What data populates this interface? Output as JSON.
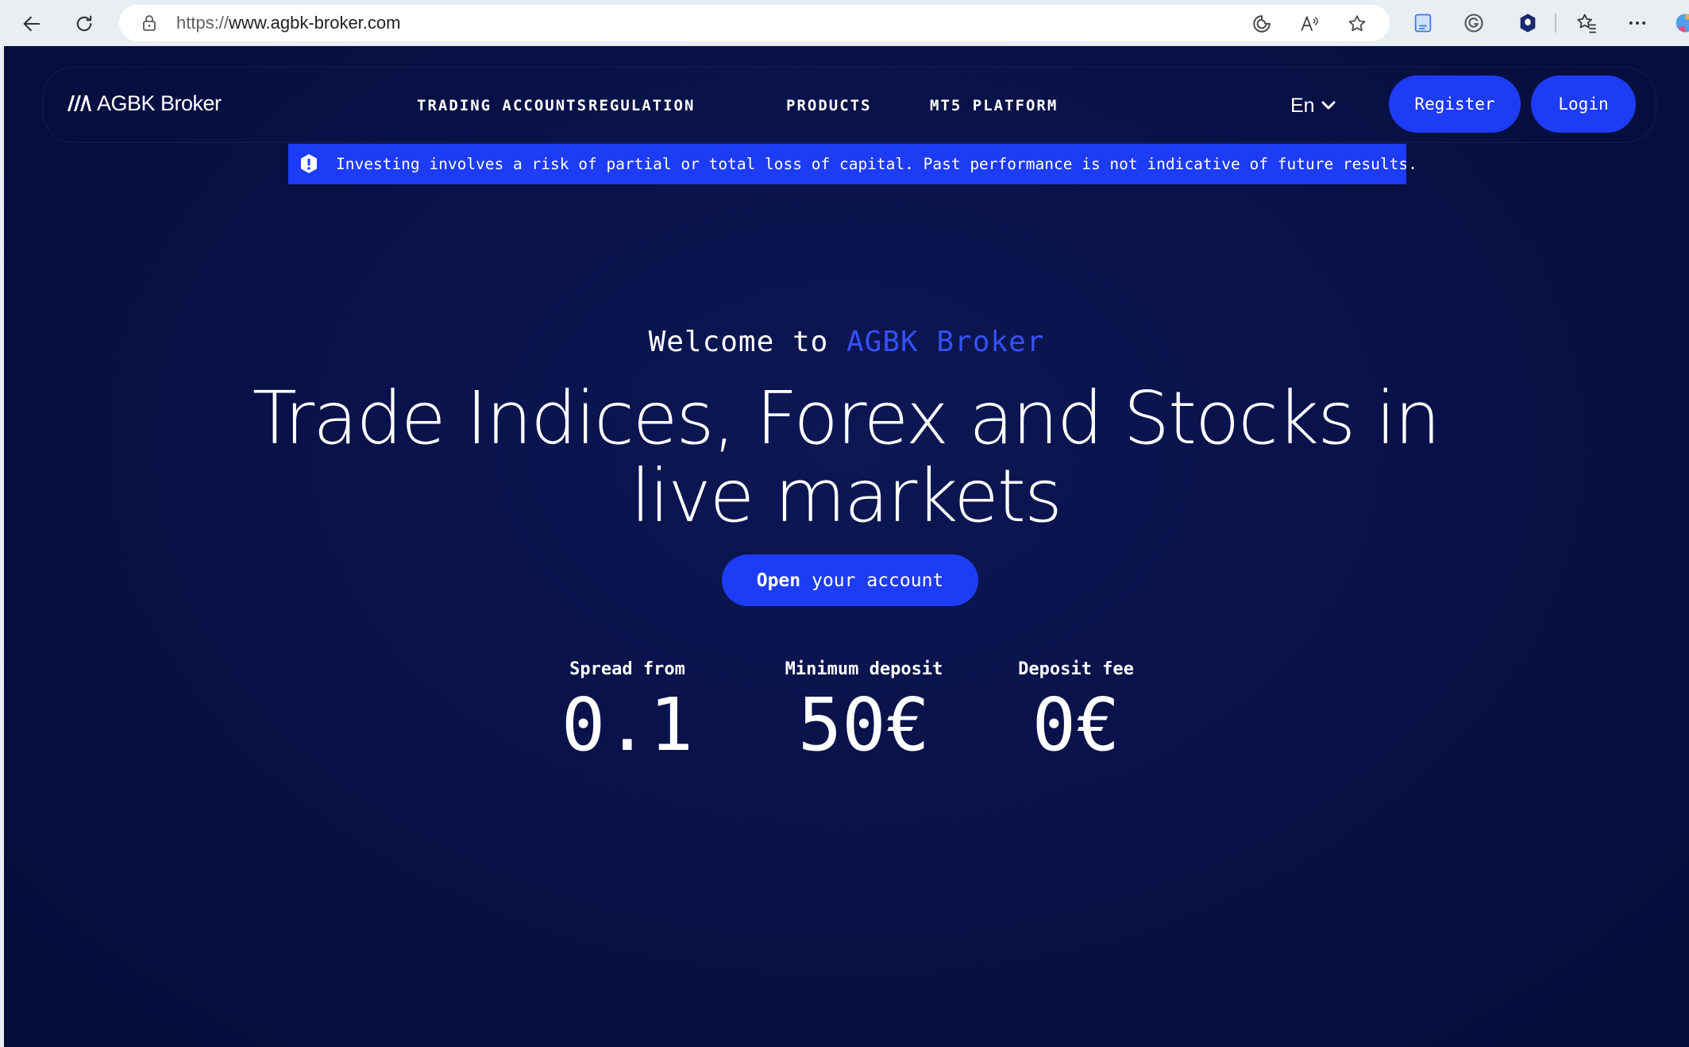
{
  "browser": {
    "url_protocol": "https://",
    "url_host": "www.agbk-broker.com"
  },
  "navbar": {
    "logo_text": "AGBK Broker",
    "menu": [
      "TRADING ACCOUNTS",
      "REGULATION",
      "PRODUCTS",
      "MT5 PLATFORM"
    ],
    "language": "En",
    "register_label": "Register",
    "login_label": "Login"
  },
  "alert": {
    "text": "Investing involves a risk of partial or total loss of capital. Past performance is not indicative of future results."
  },
  "hero": {
    "welcome_prefix": "Welcome to",
    "welcome_brand": "AGBK Broker",
    "headline_line1": "Trade Indices, Forex and Stocks in",
    "headline_line2": "live markets",
    "cta_strong": "Open",
    "cta_rest": "your account"
  },
  "stats": [
    {
      "label": "Spread from",
      "value": "0.1"
    },
    {
      "label": "Minimum deposit",
      "value": "50€"
    },
    {
      "label": "Deposit fee",
      "value": "0€"
    }
  ],
  "colors": {
    "accent": "#1d3cf5",
    "background": "#09124a",
    "text": "#ffffff"
  }
}
